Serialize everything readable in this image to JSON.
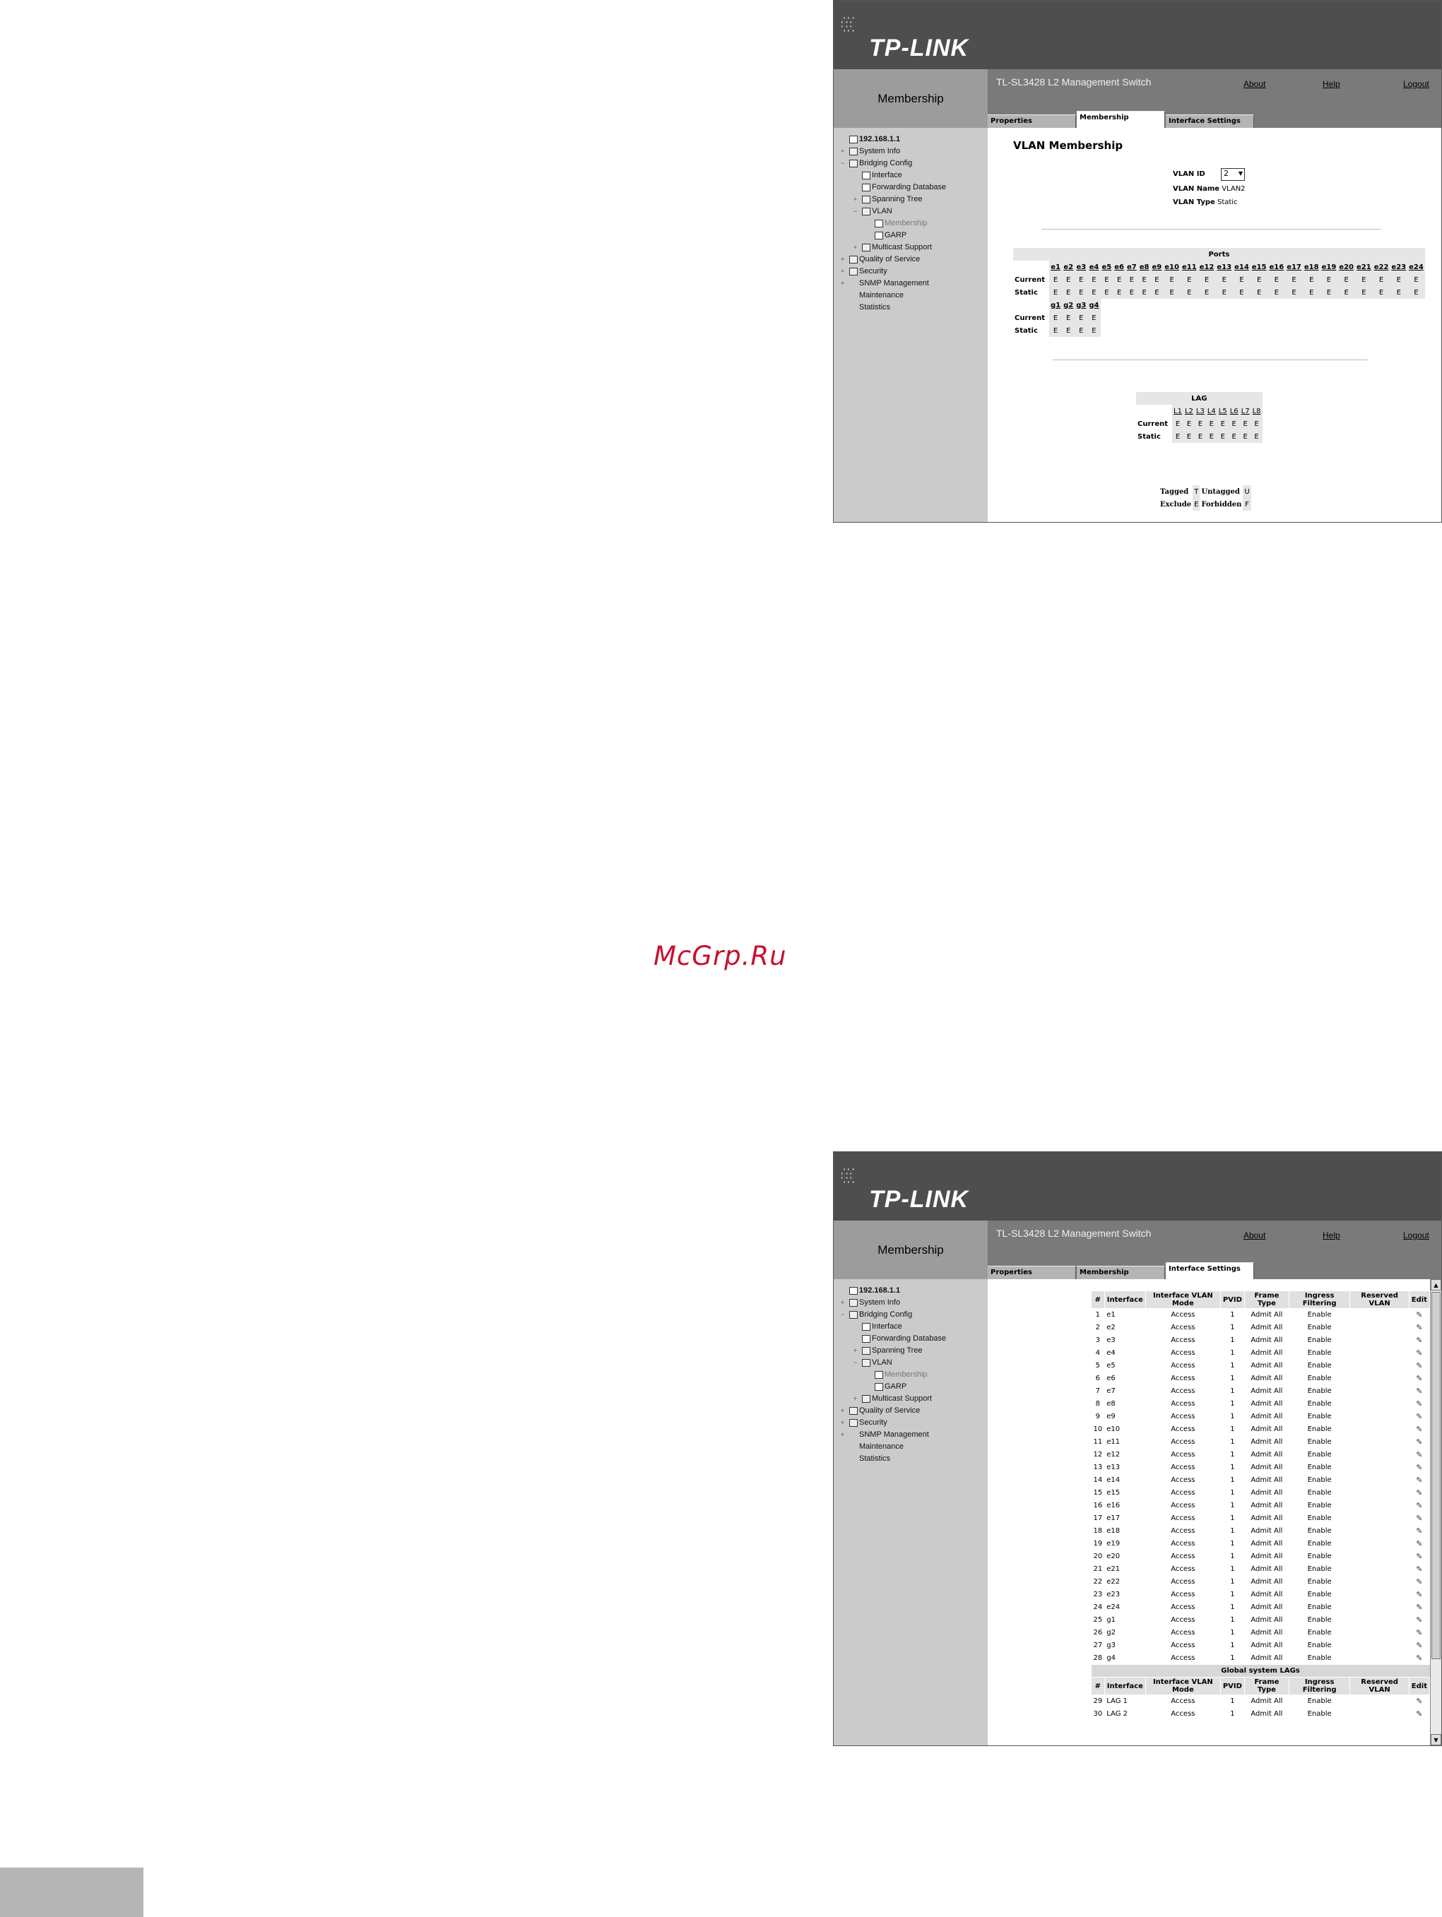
{
  "watermark": "McGrp.Ru",
  "screen1": {
    "logo": "TP-LINK",
    "side_title": "Membership",
    "product": "TL-SL3428 L2 Management Switch",
    "links": {
      "about": "About",
      "help": "Help",
      "logout": "Logout"
    },
    "tabs": [
      "Properties",
      "Membership",
      "Interface Settings"
    ],
    "active_tab": 1,
    "tree": [
      {
        "label": "192.168.1.1",
        "indent": 0,
        "toggle": "",
        "icon": "net",
        "style": "bold"
      },
      {
        "label": "System Info",
        "indent": 0,
        "toggle": "+",
        "icon": "folder",
        "style": ""
      },
      {
        "label": "Bridging Config",
        "indent": 0,
        "toggle": "−",
        "icon": "folder",
        "style": ""
      },
      {
        "label": "Interface",
        "indent": 1,
        "toggle": "",
        "icon": "page",
        "style": ""
      },
      {
        "label": "Forwarding Database",
        "indent": 1,
        "toggle": "",
        "icon": "page",
        "style": ""
      },
      {
        "label": "Spanning Tree",
        "indent": 1,
        "toggle": "+",
        "icon": "folder",
        "style": ""
      },
      {
        "label": "VLAN",
        "indent": 1,
        "toggle": "−",
        "icon": "folder",
        "style": ""
      },
      {
        "label": "Membership",
        "indent": 2,
        "toggle": "",
        "icon": "page",
        "style": "dim"
      },
      {
        "label": "GARP",
        "indent": 2,
        "toggle": "",
        "icon": "page",
        "style": ""
      },
      {
        "label": "Multicast Support",
        "indent": 1,
        "toggle": "+",
        "icon": "folder",
        "style": ""
      },
      {
        "label": "Quality of Service",
        "indent": 0,
        "toggle": "+",
        "icon": "folder",
        "style": ""
      },
      {
        "label": "Security",
        "indent": 0,
        "toggle": "+",
        "icon": "folder",
        "style": ""
      },
      {
        "label": "SNMP Management",
        "indent": 0,
        "toggle": "+",
        "icon": "none",
        "style": ""
      },
      {
        "label": "Maintenance",
        "indent": 0,
        "toggle": "",
        "icon": "none",
        "style": ""
      },
      {
        "label": "Statistics",
        "indent": 0,
        "toggle": "",
        "icon": "none",
        "style": ""
      }
    ],
    "page_title": "VLAN Membership",
    "vlan_id_label": "VLAN ID",
    "vlan_id_value": "2",
    "vlan_name_label": "VLAN Name",
    "vlan_name_value": "VLAN2",
    "vlan_type_label": "VLAN Type",
    "vlan_type_value": "Static",
    "ports_caption": "Ports",
    "ports_row1": [
      "e1",
      "e2",
      "e3",
      "e4",
      "e5",
      "e6",
      "e7",
      "e8",
      "e9",
      "e10",
      "e11",
      "e12",
      "e13",
      "e14",
      "e15",
      "e16",
      "e17",
      "e18",
      "e19",
      "e20",
      "e21",
      "e22",
      "e23",
      "e24"
    ],
    "ports_row2": [
      "g1",
      "g2",
      "g3",
      "g4"
    ],
    "current_label": "Current",
    "static_label": "Static",
    "cell_value": "E",
    "lag_caption": "LAG",
    "lags": [
      "L1",
      "L2",
      "L3",
      "L4",
      "L5",
      "L6",
      "L7",
      "L8"
    ],
    "legend": [
      {
        "label": "Tagged",
        "code": "T"
      },
      {
        "label": "Untagged",
        "code": "U"
      },
      {
        "label": "Exclude",
        "code": "E"
      },
      {
        "label": "Forbidden",
        "code": "F"
      }
    ]
  },
  "screen2": {
    "logo": "TP-LINK",
    "side_title": "Membership",
    "product": "TL-SL3428 L2 Management Switch",
    "links": {
      "about": "About",
      "help": "Help",
      "logout": "Logout"
    },
    "tabs": [
      "Properties",
      "Membership",
      "Interface Settings"
    ],
    "active_tab": 2,
    "columns": [
      "#",
      "Interface",
      "Interface VLAN Mode",
      "PVID",
      "Frame Type",
      "Ingress Filtering",
      "Reserved VLAN",
      "Edit"
    ],
    "rows": [
      [
        "1",
        "e1",
        "Access",
        "1",
        "Admit All",
        "Enable"
      ],
      [
        "2",
        "e2",
        "Access",
        "1",
        "Admit All",
        "Enable"
      ],
      [
        "3",
        "e3",
        "Access",
        "1",
        "Admit All",
        "Enable"
      ],
      [
        "4",
        "e4",
        "Access",
        "1",
        "Admit All",
        "Enable"
      ],
      [
        "5",
        "e5",
        "Access",
        "1",
        "Admit All",
        "Enable"
      ],
      [
        "6",
        "e6",
        "Access",
        "1",
        "Admit All",
        "Enable"
      ],
      [
        "7",
        "e7",
        "Access",
        "1",
        "Admit All",
        "Enable"
      ],
      [
        "8",
        "e8",
        "Access",
        "1",
        "Admit All",
        "Enable"
      ],
      [
        "9",
        "e9",
        "Access",
        "1",
        "Admit All",
        "Enable"
      ],
      [
        "10",
        "e10",
        "Access",
        "1",
        "Admit All",
        "Enable"
      ],
      [
        "11",
        "e11",
        "Access",
        "1",
        "Admit All",
        "Enable"
      ],
      [
        "12",
        "e12",
        "Access",
        "1",
        "Admit All",
        "Enable"
      ],
      [
        "13",
        "e13",
        "Access",
        "1",
        "Admit All",
        "Enable"
      ],
      [
        "14",
        "e14",
        "Access",
        "1",
        "Admit All",
        "Enable"
      ],
      [
        "15",
        "e15",
        "Access",
        "1",
        "Admit All",
        "Enable"
      ],
      [
        "16",
        "e16",
        "Access",
        "1",
        "Admit All",
        "Enable"
      ],
      [
        "17",
        "e17",
        "Access",
        "1",
        "Admit All",
        "Enable"
      ],
      [
        "18",
        "e18",
        "Access",
        "1",
        "Admit All",
        "Enable"
      ],
      [
        "19",
        "e19",
        "Access",
        "1",
        "Admit All",
        "Enable"
      ],
      [
        "20",
        "e20",
        "Access",
        "1",
        "Admit All",
        "Enable"
      ],
      [
        "21",
        "e21",
        "Access",
        "1",
        "Admit All",
        "Enable"
      ],
      [
        "22",
        "e22",
        "Access",
        "1",
        "Admit All",
        "Enable"
      ],
      [
        "23",
        "e23",
        "Access",
        "1",
        "Admit All",
        "Enable"
      ],
      [
        "24",
        "e24",
        "Access",
        "1",
        "Admit All",
        "Enable"
      ],
      [
        "25",
        "g1",
        "Access",
        "1",
        "Admit All",
        "Enable"
      ],
      [
        "26",
        "g2",
        "Access",
        "1",
        "Admit All",
        "Enable"
      ],
      [
        "27",
        "g3",
        "Access",
        "1",
        "Admit All",
        "Enable"
      ],
      [
        "28",
        "g4",
        "Access",
        "1",
        "Admit All",
        "Enable"
      ]
    ],
    "lag_section_title": "Global system LAGs",
    "lag_rows": [
      [
        "29",
        "LAG 1",
        "Access",
        "1",
        "Admit All",
        "Enable"
      ],
      [
        "30",
        "LAG 2",
        "Access",
        "1",
        "Admit All",
        "Enable"
      ]
    ],
    "edit_icon": "pencil-icon"
  }
}
